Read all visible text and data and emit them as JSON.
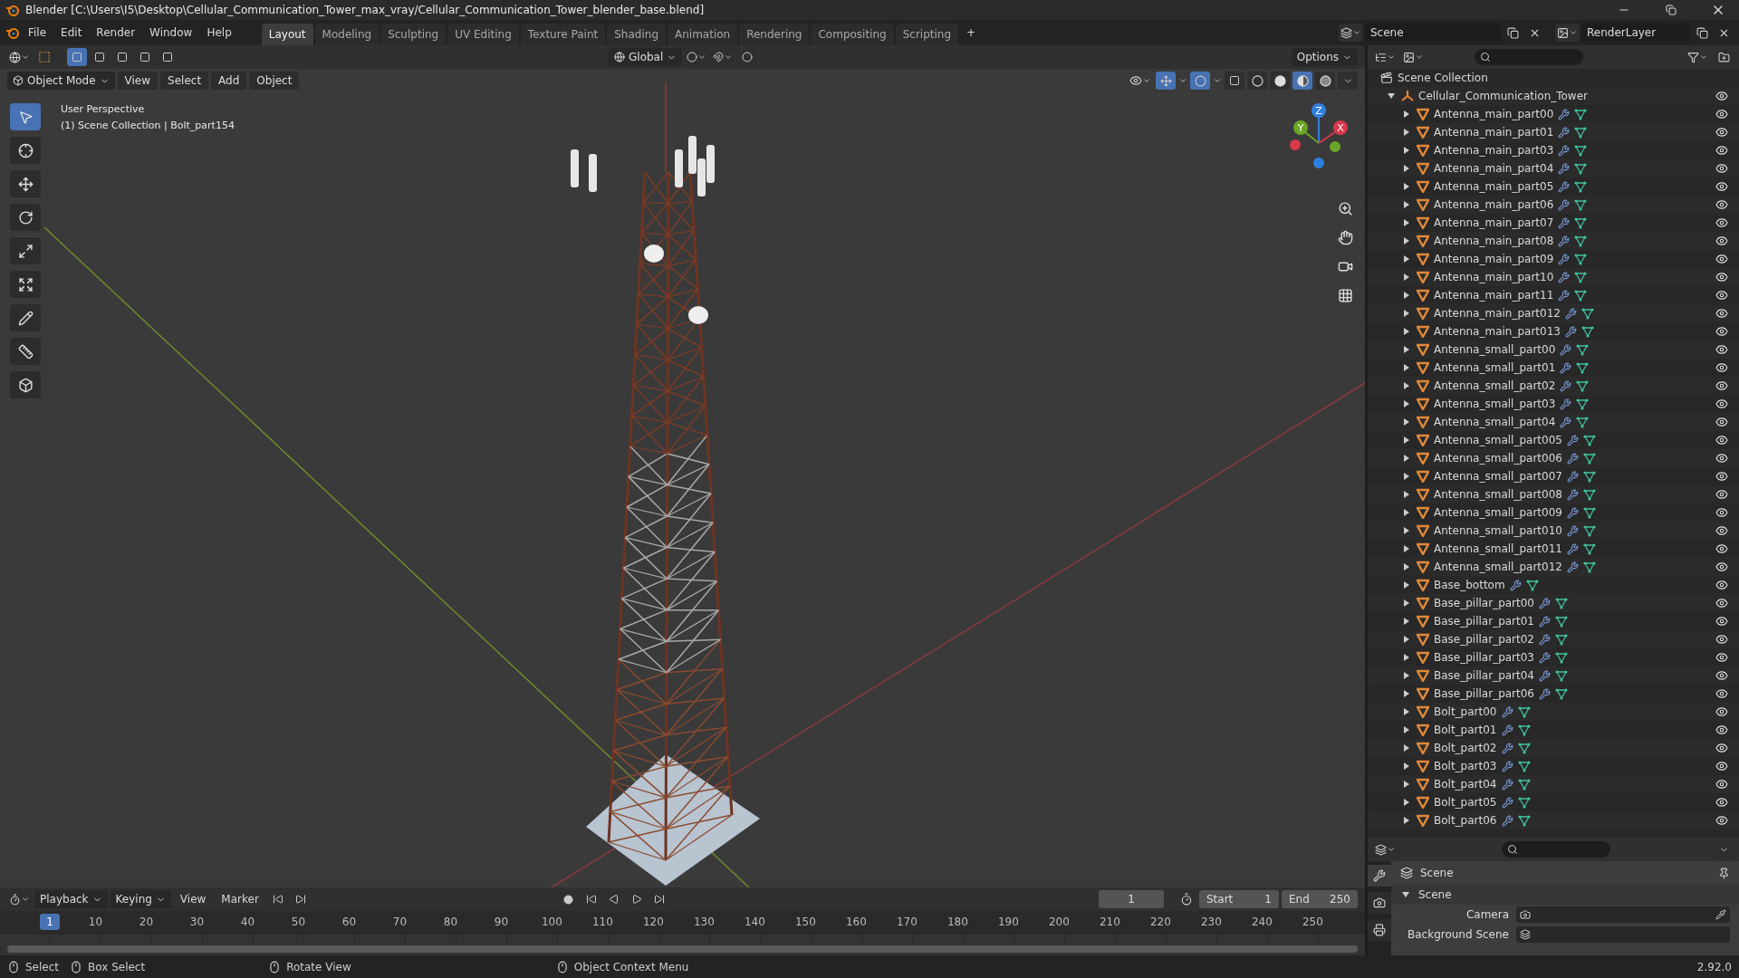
{
  "window": {
    "title": "Blender [C:\\Users\\I5\\Desktop\\Cellular_Communication_Tower_max_vray/Cellular_Communication_Tower_blender_base.blend]"
  },
  "menus": [
    "File",
    "Edit",
    "Render",
    "Window",
    "Help"
  ],
  "workspaces": [
    {
      "label": "Layout",
      "selected": true
    },
    {
      "label": "Modeling",
      "selected": false
    },
    {
      "label": "Sculpting",
      "selected": false
    },
    {
      "label": "UV Editing",
      "selected": false
    },
    {
      "label": "Texture Paint",
      "selected": false
    },
    {
      "label": "Shading",
      "selected": false
    },
    {
      "label": "Animation",
      "selected": false
    },
    {
      "label": "Rendering",
      "selected": false
    },
    {
      "label": "Compositing",
      "selected": false
    },
    {
      "label": "Scripting",
      "selected": false
    }
  ],
  "add_workspace": "+",
  "scene_field": {
    "value": "Scene"
  },
  "view_layer_field": {
    "value": "RenderLayer"
  },
  "tool_settings": {
    "select_modes": [
      {
        "selected": true
      },
      {
        "selected": false
      },
      {
        "selected": false
      },
      {
        "selected": false
      },
      {
        "selected": false
      }
    ],
    "orientation": "Global",
    "options": "Options"
  },
  "viewport": {
    "mode": "Object Mode",
    "menus": [
      "View",
      "Select",
      "Add",
      "Object"
    ],
    "overlay_text": [
      "User Perspective",
      "(1) Scene Collection | Bolt_part154"
    ],
    "shading_modes": [
      {
        "kind": "wireframe",
        "selected": false
      },
      {
        "kind": "solid",
        "selected": false
      },
      {
        "kind": "material",
        "selected": true
      },
      {
        "kind": "rendered",
        "selected": false
      }
    ],
    "tools": [
      {
        "kind": "select",
        "selected": true
      },
      {
        "kind": "cursor",
        "selected": false
      },
      {
        "kind": "move",
        "selected": false
      },
      {
        "kind": "rotate",
        "selected": false
      },
      {
        "kind": "scale",
        "selected": false
      },
      {
        "kind": "transform",
        "selected": false
      },
      {
        "kind": "annotate",
        "selected": false
      },
      {
        "kind": "measure",
        "selected": false
      },
      {
        "kind": "add_cube",
        "selected": false
      }
    ],
    "gizmo_axes": [
      {
        "label": "Z",
        "color": "#2f7fe0"
      },
      {
        "label": "Y",
        "color": "#6aa526"
      },
      {
        "label": "X",
        "color": "#d8384a"
      }
    ]
  },
  "outliner": {
    "root": "Scene Collection",
    "tree": [
      {
        "name": "Cellular_Communication_Tower",
        "expanded": true,
        "children": [
          {
            "name": "Antenna_main_part00",
            "expanded": false
          },
          {
            "name": "Antenna_main_part01",
            "expanded": false
          },
          {
            "name": "Antenna_main_part03",
            "expanded": false
          },
          {
            "name": "Antenna_main_part04",
            "expanded": false
          },
          {
            "name": "Antenna_main_part05",
            "expanded": false
          },
          {
            "name": "Antenna_main_part06",
            "expanded": false
          },
          {
            "name": "Antenna_main_part07",
            "expanded": false
          },
          {
            "name": "Antenna_main_part08",
            "expanded": false
          },
          {
            "name": "Antenna_main_part09",
            "expanded": false
          },
          {
            "name": "Antenna_main_part10",
            "expanded": false
          },
          {
            "name": "Antenna_main_part11",
            "expanded": false
          },
          {
            "name": "Antenna_main_part012",
            "expanded": false
          },
          {
            "name": "Antenna_main_part013",
            "expanded": false
          },
          {
            "name": "Antenna_small_part00",
            "expanded": false
          },
          {
            "name": "Antenna_small_part01",
            "expanded": false
          },
          {
            "name": "Antenna_small_part02",
            "expanded": false
          },
          {
            "name": "Antenna_small_part03",
            "expanded": false
          },
          {
            "name": "Antenna_small_part04",
            "expanded": false
          },
          {
            "name": "Antenna_small_part005",
            "expanded": false
          },
          {
            "name": "Antenna_small_part006",
            "expanded": false
          },
          {
            "name": "Antenna_small_part007",
            "expanded": false
          },
          {
            "name": "Antenna_small_part008",
            "expanded": false
          },
          {
            "name": "Antenna_small_part009",
            "expanded": false
          },
          {
            "name": "Antenna_small_part010",
            "expanded": false
          },
          {
            "name": "Antenna_small_part011",
            "expanded": false
          },
          {
            "name": "Antenna_small_part012",
            "expanded": false
          },
          {
            "name": "Base_bottom",
            "expanded": false
          },
          {
            "name": "Base_pillar_part00",
            "expanded": false
          },
          {
            "name": "Base_pillar_part01",
            "expanded": false
          },
          {
            "name": "Base_pillar_part02",
            "expanded": false
          },
          {
            "name": "Base_pillar_part03",
            "expanded": false
          },
          {
            "name": "Base_pillar_part04",
            "expanded": false
          },
          {
            "name": "Base_pillar_part06",
            "expanded": false
          },
          {
            "name": "Bolt_part00",
            "expanded": false
          },
          {
            "name": "Bolt_part01",
            "expanded": false
          },
          {
            "name": "Bolt_part02",
            "expanded": false
          },
          {
            "name": "Bolt_part03",
            "expanded": false
          },
          {
            "name": "Bolt_part04",
            "expanded": false
          },
          {
            "name": "Bolt_part05",
            "expanded": false
          },
          {
            "name": "Bolt_part06",
            "expanded": false
          }
        ]
      }
    ]
  },
  "timeline": {
    "menus": [
      "Playback",
      "Keying",
      "View",
      "Marker"
    ],
    "current_frame": "1",
    "start_label": "Start",
    "start": "1",
    "end_label": "End",
    "end": "250",
    "playhead": "1",
    "ruler_labels": [
      "10",
      "20",
      "30",
      "40",
      "50",
      "60",
      "70",
      "80",
      "90",
      "100",
      "110",
      "120",
      "130",
      "140",
      "150",
      "160",
      "170",
      "180",
      "190",
      "200",
      "210",
      "220",
      "230",
      "240",
      "250"
    ]
  },
  "properties": {
    "context": "Scene",
    "panel": {
      "title": "Scene",
      "expanded": true
    },
    "fields": [
      {
        "label": "Camera"
      },
      {
        "label": "Background Scene"
      }
    ]
  },
  "status_bar": {
    "hints": [
      {
        "label": "Select"
      },
      {
        "label": "Box Select"
      },
      {
        "label": "Rotate View"
      },
      {
        "label": "Object Context Menu"
      }
    ],
    "version": "2.92.0"
  }
}
